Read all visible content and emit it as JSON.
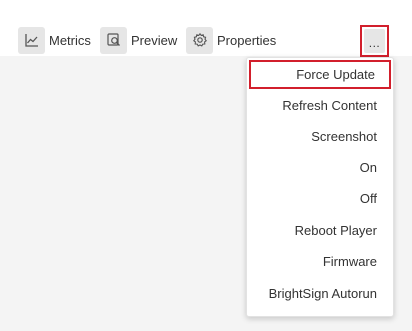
{
  "toolbar": {
    "metrics": {
      "label": "Metrics",
      "icon": "line-chart-icon"
    },
    "preview": {
      "label": "Preview",
      "icon": "preview-search-icon"
    },
    "properties": {
      "label": "Properties",
      "icon": "gear-icon"
    },
    "more": {
      "label": "...",
      "icon": "more-options-icon"
    }
  },
  "menu": {
    "items": [
      {
        "label": "Force Update"
      },
      {
        "label": "Refresh Content"
      },
      {
        "label": "Screenshot"
      },
      {
        "label": "On"
      },
      {
        "label": "Off"
      },
      {
        "label": "Reboot Player"
      },
      {
        "label": "Firmware"
      },
      {
        "label": "BrightSign Autorun"
      }
    ]
  },
  "colors": {
    "highlight": "#d21f2c",
    "icon_bg": "#e6e6e6",
    "text": "#333333",
    "page_bg": "#f4f4f4"
  }
}
